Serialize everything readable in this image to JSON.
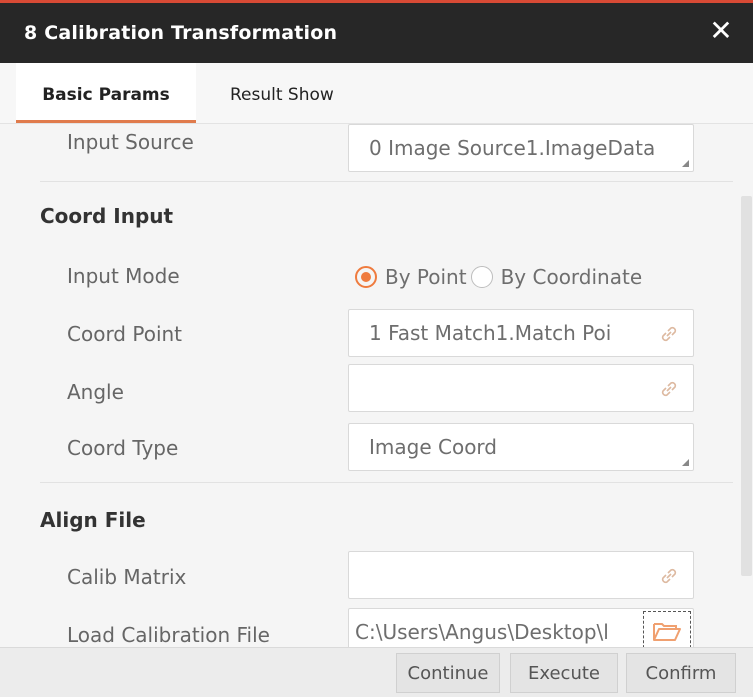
{
  "window": {
    "title": "8 Calibration Transformation",
    "close_icon": "close-icon"
  },
  "tabs": [
    {
      "label": "Basic Params",
      "active": true
    },
    {
      "label": "Result Show",
      "active": false
    }
  ],
  "input_source": {
    "label": "Input Source",
    "value": "0 Image Source1.ImageData"
  },
  "coord_input": {
    "section_title": "Coord Input",
    "input_mode": {
      "label": "Input Mode",
      "options": [
        "By Point",
        "By Coordinate"
      ],
      "selected": "By Point"
    },
    "coord_point": {
      "label": "Coord Point",
      "value": "1 Fast Match1.Match Poi"
    },
    "angle": {
      "label": "Angle",
      "value": ""
    },
    "coord_type": {
      "label": "Coord Type",
      "value": "Image Coord"
    }
  },
  "align_file": {
    "section_title": "Align File",
    "calib_matrix": {
      "label": "Calib Matrix",
      "value": ""
    },
    "load_calibration_file": {
      "label": "Load Calibration File",
      "value": "C:\\Users\\Angus\\Desktop\\l"
    }
  },
  "footer": {
    "continue": "Continue",
    "execute": "Execute",
    "confirm": "Confirm"
  },
  "colors": {
    "accent": "#ef7b3e",
    "titlebar": "#272727",
    "top_line": "#d84a35"
  }
}
